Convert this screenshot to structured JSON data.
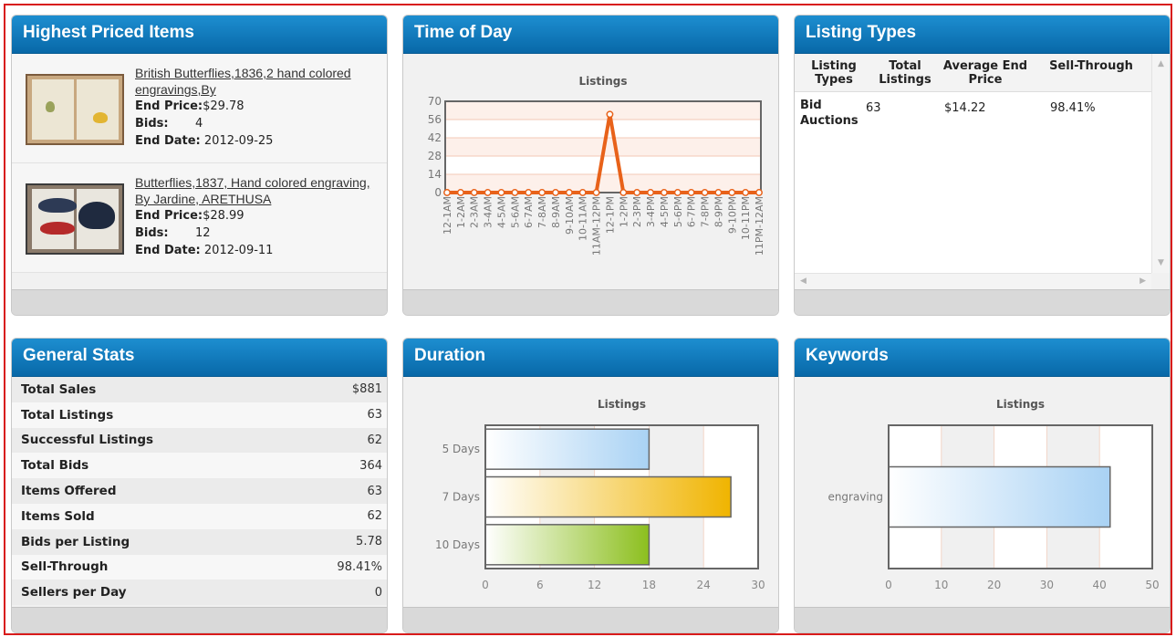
{
  "highest_priced": {
    "title": "Highest Priced Items",
    "items": [
      {
        "title": "British Butterflies,1836,2 hand colored engravings,By",
        "end_price_label": "End Price:",
        "end_price": "$29.78",
        "bids_label": "Bids:",
        "bids": "4",
        "end_date_label": "End Date:",
        "end_date": "2012-09-25"
      },
      {
        "title": "Butterflies,1837, Hand colored engraving, By Jardine, ARETHUSA",
        "end_price_label": "End Price:",
        "end_price": "$28.99",
        "bids_label": "Bids:",
        "bids": "12",
        "end_date_label": "End Date:",
        "end_date": "2012-09-11"
      }
    ]
  },
  "time_of_day": {
    "title": "Time of Day"
  },
  "listing_types": {
    "title": "Listing Types",
    "columns": [
      "Listing Types",
      "Total Listings",
      "Average End Price",
      "Sell-Through"
    ],
    "rows": [
      {
        "type": "Bid Auctions",
        "total": "63",
        "avg": "$14.22",
        "sell": "98.41%"
      }
    ]
  },
  "general_stats": {
    "title": "General Stats",
    "rows": [
      {
        "label": "Total Sales",
        "value": "$881"
      },
      {
        "label": "Total Listings",
        "value": "63"
      },
      {
        "label": "Successful Listings",
        "value": "62"
      },
      {
        "label": "Total Bids",
        "value": "364"
      },
      {
        "label": "Items Offered",
        "value": "63"
      },
      {
        "label": "Items Sold",
        "value": "62"
      },
      {
        "label": "Bids per Listing",
        "value": "5.78"
      },
      {
        "label": "Sell-Through",
        "value": "98.41%"
      },
      {
        "label": "Sellers per Day",
        "value": "0"
      }
    ]
  },
  "duration": {
    "title": "Duration"
  },
  "keywords": {
    "title": "Keywords"
  },
  "colors": {
    "header_blue": "#0b72b6",
    "line_orange": "#e8621a",
    "bar_blue": "#a9d2f4",
    "bar_gold": "#f0b400",
    "bar_green": "#8cbf1e",
    "frame_red": "#d81b1b"
  },
  "chart_data": [
    {
      "type": "line",
      "title": "Listings",
      "x": [
        "12-1AM",
        "1-2AM",
        "2-3AM",
        "3-4AM",
        "4-5AM",
        "5-6AM",
        "6-7AM",
        "7-8AM",
        "8-9AM",
        "9-10AM",
        "10-11AM",
        "11AM-12PM",
        "12-1PM",
        "1-2PM",
        "2-3PM",
        "3-4PM",
        "4-5PM",
        "5-6PM",
        "6-7PM",
        "7-8PM",
        "8-9PM",
        "9-10PM",
        "10-11PM",
        "11PM-12AM"
      ],
      "series": [
        {
          "values": [
            0,
            0,
            0,
            0,
            0,
            0,
            0,
            0,
            0,
            0,
            0,
            0,
            60,
            0,
            0,
            0,
            0,
            0,
            0,
            0,
            0,
            0,
            0,
            0
          ]
        }
      ],
      "yticks": [
        0,
        14,
        28,
        42,
        56,
        70
      ],
      "ylim": [
        0,
        70
      ],
      "grid": true
    },
    {
      "type": "bar",
      "title": "Listings",
      "orientation": "horizontal",
      "categories": [
        "5 Days",
        "7 Days",
        "10 Days"
      ],
      "values": [
        18,
        27,
        18
      ],
      "xticks": [
        0,
        6,
        12,
        18,
        24,
        30
      ],
      "xlim": [
        0,
        30
      ]
    },
    {
      "type": "bar",
      "title": "Listings",
      "orientation": "horizontal",
      "categories": [
        "engraving"
      ],
      "values": [
        42
      ],
      "xticks": [
        0,
        10,
        20,
        30,
        40,
        50
      ],
      "xlim": [
        0,
        50
      ]
    }
  ]
}
